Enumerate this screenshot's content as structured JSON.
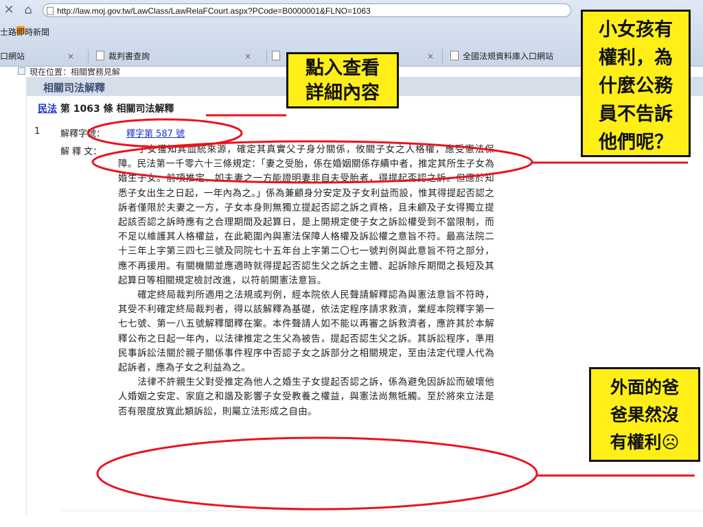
{
  "browser": {
    "address": "http://law.moj.gov.tw/LawClass/LawRelaFCourt.aspx?PCode=B0000001&FLNO=1063",
    "favorites": [
      {
        "label": "士路"
      },
      {
        "label": "即時新聞"
      }
    ],
    "tabs": [
      {
        "label": "口網站",
        "close": "×"
      },
      {
        "label": "裁判書查詢",
        "close": "×"
      },
      {
        "label": "",
        "close": "×"
      },
      {
        "label": "全國法規資料庫入口網站",
        "close": "×"
      }
    ]
  },
  "page": {
    "location": "現在位置：相關實務見解",
    "panel_title": "相關司法解釋",
    "law_link": "民法",
    "subtitle_rest": " 第 1063 條 相關司法解釋",
    "entry": {
      "number": "1",
      "label_no": "解釋字號：",
      "link": "釋字第 587 號",
      "label_text": "解 釋 文："
    },
    "paragraphs": [
      "子女獲知其血統來源，確定其真實父子身分關係，攸關子女之人格權，應受憲法保障。民法第一千零六十三條規定：「妻之受胎，係在婚姻關係存續中者，推定其所生子女為婚生子女。前項推定，如夫妻之一方能證明妻非自夫受胎者，得提起否認之訴。但應於知悉子女出生之日起，一年內為之。」係為兼顧身分安定及子女利益而設，惟其得提起否認之訴者僅限於夫妻之一方，子女本身則無獨立提起否認之訴之資格，且未顧及子女得獨立提起該否認之訴時應有之合理期間及起算日，是上開規定使子女之訴訟權受到不當限制，而不足以維護其人格權益，在此範圍內與憲法保障人格權及訴訟權之意旨不符。最高法院二十三年上字第三四七三號及同院七十五年台上字第二〇七一號判例與此意旨不符之部分，應不再援用。有關機關並應適時就得提起否認生父之訴之主體、起訴除斥期間之長短及其起算日等相關規定檢討改進，以符前開憲法意旨。",
      "確定終局裁判所適用之法規或判例，經本院依人民聲請解釋認為與憲法意旨不符時，其受不利確定終局裁判者，得以該解釋為基礎，依法定程序請求救濟，業經本院釋字第一七七號、第一八五號解釋闡釋在案。本件聲請人如不能以再審之訴救濟者，應許其於本解釋公布之日起一年內，以法律推定之生父為被告，提起否認生父之訴。其訴訟程序，準用民事訴訟法關於親子關係事件程序中否認子女之訴部分之相關規定，至由法定代理人代為起訴者，應為子女之利益為之。",
      "法律不許親生父對受推定為他人之婚生子女提起否認之訴，係為避免因訴訟而破壞他人婚姻之安定、家庭之和諧及影響子女受教養之權益，與憲法尚無牴觸。至於將來立法是否有限度放寬此類訴訟，則屬立法形成之自由。"
    ]
  },
  "annotations": {
    "click_callout": [
      "點入查看",
      "詳細內容"
    ],
    "child_callout": [
      "小女孩有",
      "權利，為",
      "什麼公務",
      "員不告訴",
      "他們呢？"
    ],
    "father_callout": [
      "外面的爸",
      "爸果然沒",
      "有權利☹"
    ],
    "accent_color": "#ffef16",
    "ring_color": "#e8141e"
  }
}
